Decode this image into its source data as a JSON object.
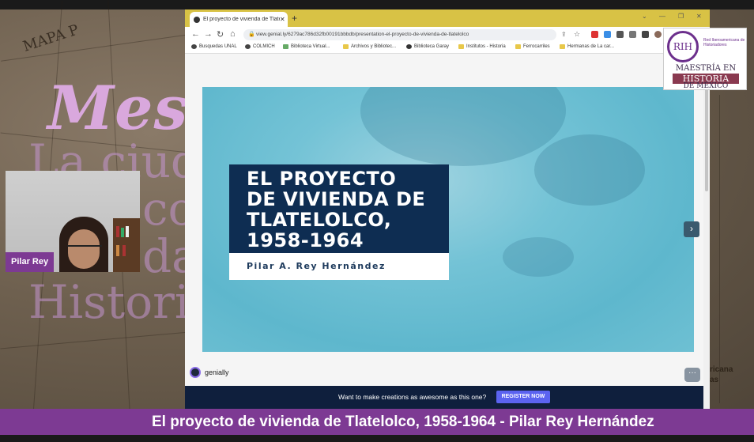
{
  "background": {
    "map_label": "MAPA P",
    "mesa_title": "Mesa",
    "lines": [
      "La ciud",
      "co",
      "da",
      "Histori"
    ],
    "side_labels": [
      "ricana",
      "as"
    ]
  },
  "webcam": {
    "participant_name": "Pilar Rey"
  },
  "browser": {
    "tab_title": "El proyecto de vivienda de Tlatelolco",
    "tab_close": "✕",
    "new_tab": "+",
    "url": "view.genial.ly/6279ac786d32fb00191bbbdb/presentation-el-proyecto-de-vivienda-de-tlatelolco",
    "bookmarks": [
      "Busquedas UNAL",
      "COLMICH",
      "Biblioteca Virtual...",
      "Archivos y Bibliotec...",
      "Biblioteca Garay",
      "Institutos - Historia",
      "Ferrocarriles",
      "Hermanas de La car..."
    ]
  },
  "slide": {
    "title_lines": [
      "EL PROYECTO",
      "DE VIVIENDA DE",
      "TLATELOLCO,",
      "1958-1964"
    ],
    "author": "Pilar A. Rey Hernández",
    "next_glyph": "›"
  },
  "genially": {
    "brand": "genially",
    "more_glyph": "···",
    "promo_text": "Want to make creations as awesome as this one?",
    "promo_button": "REGISTER NOW"
  },
  "logo": {
    "circle_text": "RIH",
    "network_name": "Red Iberoamericana de Historiadores",
    "line1": "MAESTRÍA EN",
    "line2": "HISTORIA",
    "line3": "DE MÉXICO"
  },
  "lower_third": {
    "text": "El proyecto de vivienda de Tlatelolco, 1958-1964 - Pilar Rey Hernández"
  },
  "colors": {
    "accent_purple": "#7d3a93",
    "tab_strip": "#d8c245",
    "slide_title_bg": "#0e2d52",
    "promo_bar": "#0f1f3d",
    "promo_button": "#5b63f0"
  }
}
